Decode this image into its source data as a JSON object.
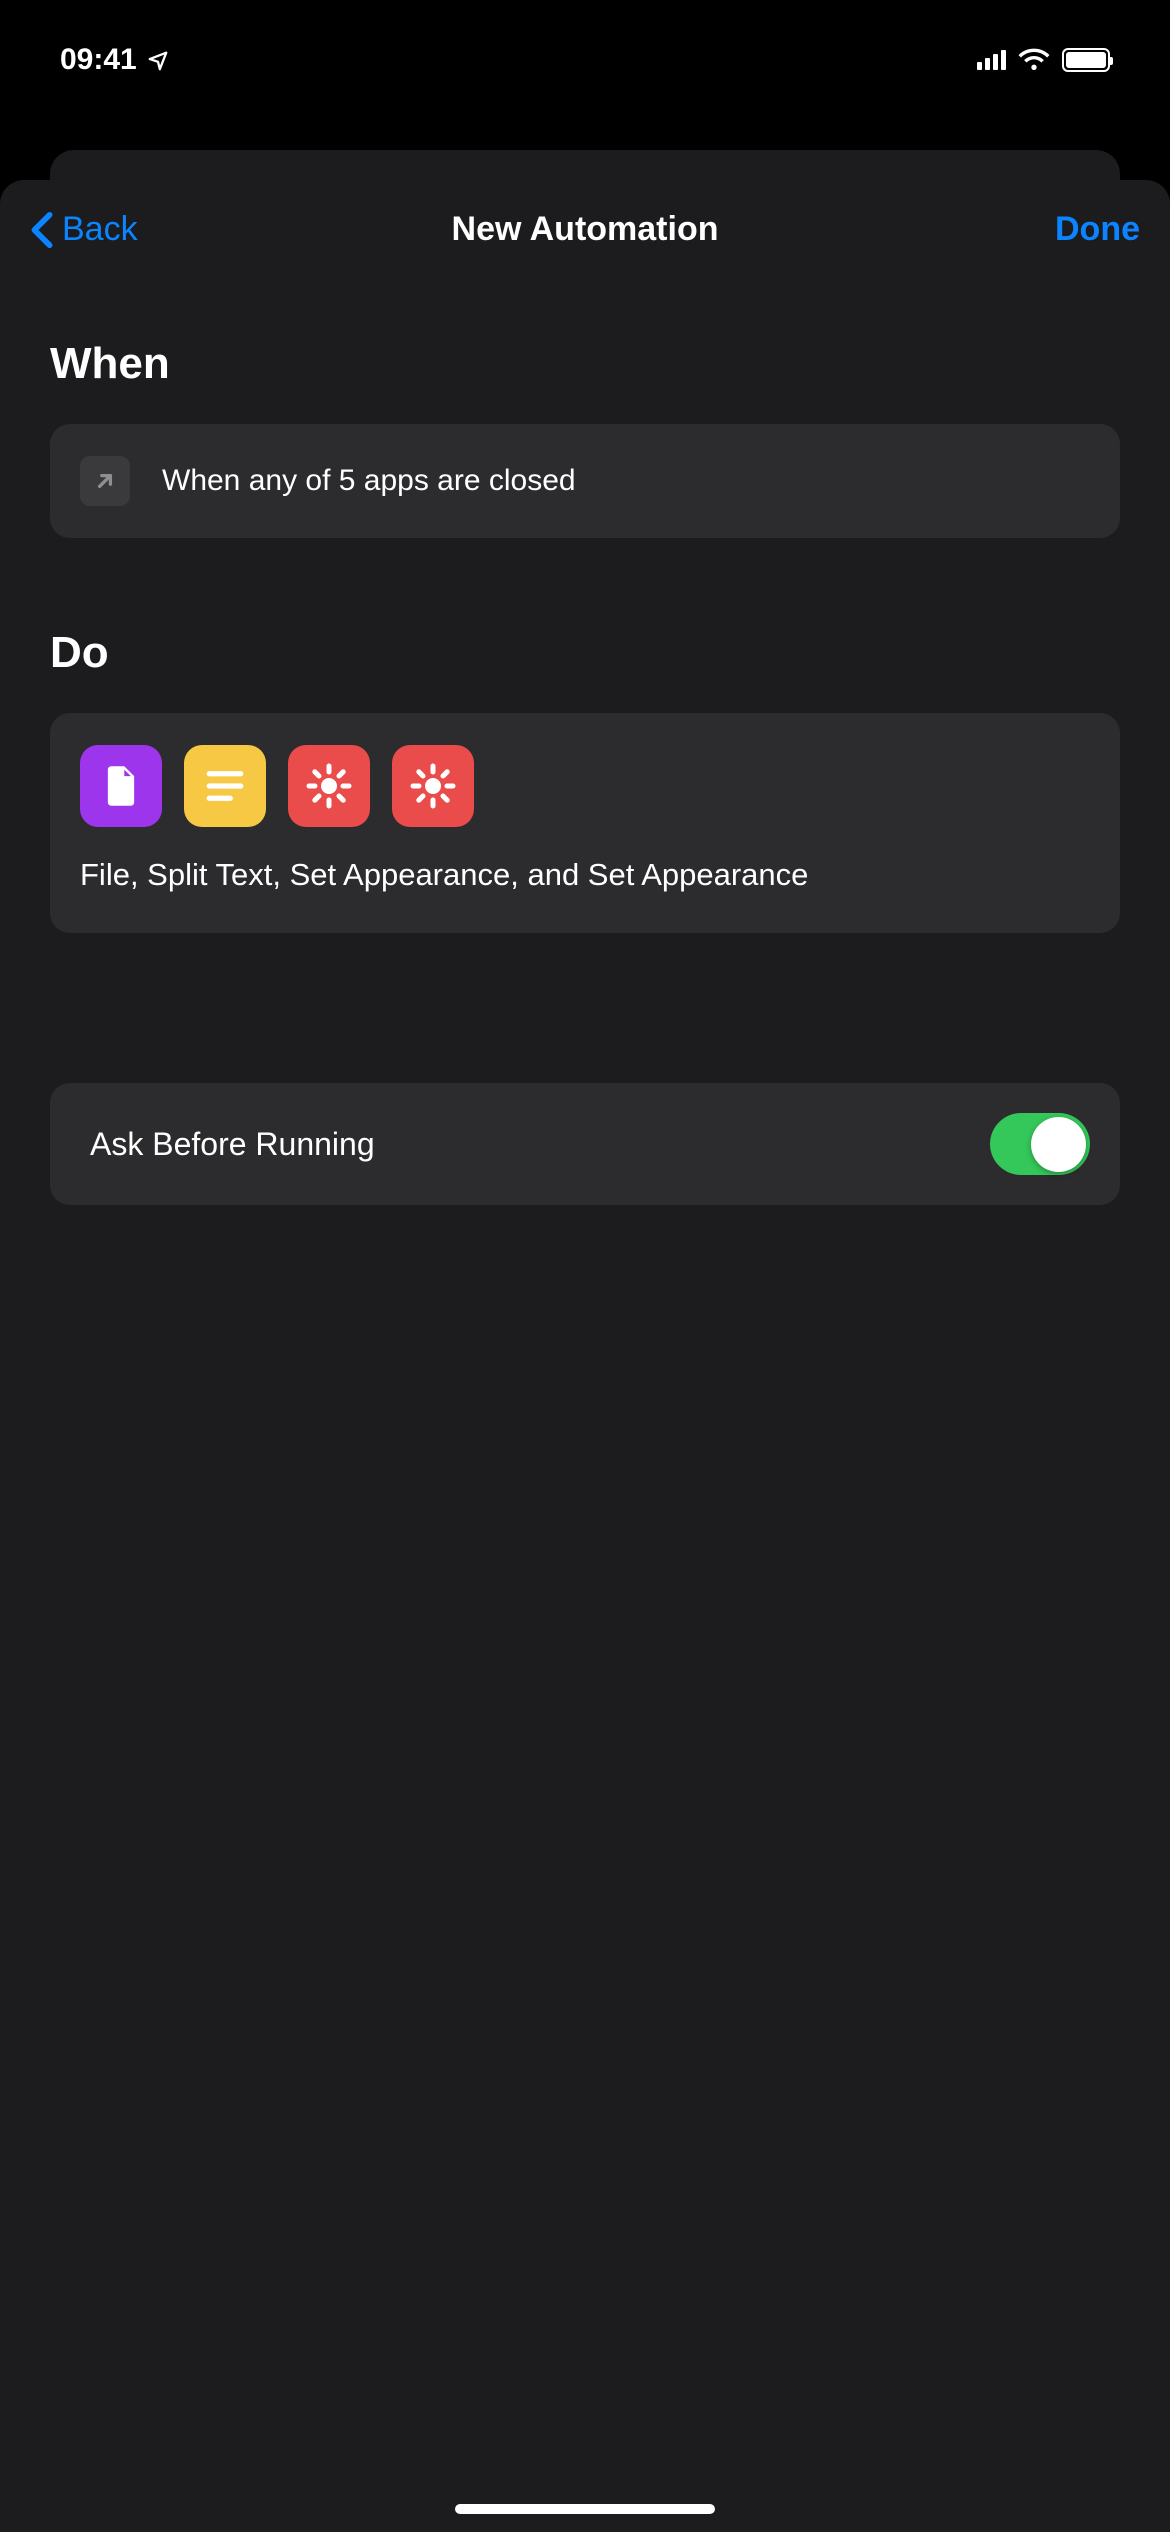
{
  "status_bar": {
    "time": "09:41"
  },
  "nav": {
    "back_label": "Back",
    "title": "New Automation",
    "done_label": "Done"
  },
  "sections": {
    "when": {
      "title": "When",
      "description": "When any of 5 apps are closed"
    },
    "do": {
      "title": "Do",
      "action_summary": "File, Split Text, Set Appearance, and Set Appearance",
      "icons": [
        {
          "name": "file-icon",
          "color": "purple"
        },
        {
          "name": "text-icon",
          "color": "yellow"
        },
        {
          "name": "appearance-icon",
          "color": "red"
        },
        {
          "name": "appearance-icon",
          "color": "red"
        }
      ]
    },
    "options": {
      "ask_before_running_label": "Ask Before Running",
      "ask_before_running_enabled": true
    }
  }
}
